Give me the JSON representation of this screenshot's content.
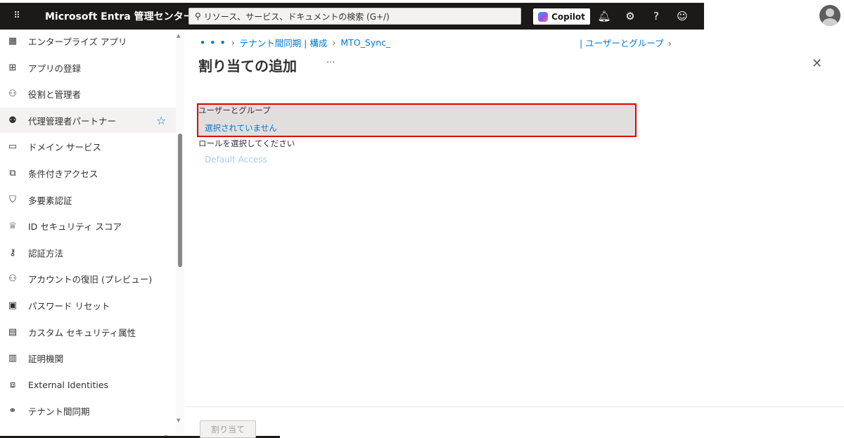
{
  "topbar": {
    "brand": "Microsoft Entra 管理センター",
    "search_placeholder": "リソース、サービス、ドキュメントの検索 (G+/)",
    "copilot_label": "Copilot",
    "icons": [
      "waffle-icon",
      "search-icon",
      "bell-icon",
      "gear-icon",
      "help-icon",
      "feedback-icon",
      "avatar"
    ]
  },
  "sidebar": {
    "items": [
      {
        "label": "エンタープライズ アプリ",
        "icon": "enterprise-apps-icon"
      },
      {
        "label": "アプリの登録",
        "icon": "app-registration-icon"
      },
      {
        "label": "役割と管理者",
        "icon": "roles-icon"
      },
      {
        "label": "代理管理者パートナー",
        "icon": "delegated-admin-icon",
        "selected": true,
        "favorite": true
      },
      {
        "label": "ドメイン サービス",
        "icon": "domain-services-icon"
      },
      {
        "label": "条件付きアクセス",
        "icon": "conditional-access-icon"
      },
      {
        "label": "多要素認証",
        "icon": "mfa-icon"
      },
      {
        "label": "ID セキュリティ スコア",
        "icon": "trophy-icon"
      },
      {
        "label": "認証方法",
        "icon": "auth-methods-icon"
      },
      {
        "label": "アカウントの復旧 (プレビュー)",
        "icon": "account-recovery-icon"
      },
      {
        "label": "パスワード リセット",
        "icon": "password-reset-icon"
      },
      {
        "label": "カスタム セキュリティ属性",
        "icon": "custom-attributes-icon"
      },
      {
        "label": "証明機関",
        "icon": "certificate-icon"
      },
      {
        "label": "External Identities",
        "icon": "external-identities-icon"
      },
      {
        "label": "テナント間同期",
        "icon": "cross-tenant-sync-icon"
      }
    ]
  },
  "breadcrumb": {
    "ellipsis": "• • •",
    "items": [
      "テナント間同期 | 構成",
      "MTO_Sync_"
    ],
    "trailing": "| ユーザーとグループ"
  },
  "page": {
    "title": "割り当ての追加",
    "more": "···",
    "close": "✕"
  },
  "form": {
    "users_label": "ユーザーとグループ",
    "users_value": "選択されていません",
    "role_label": "ロールを選択してください",
    "role_value": "Default Access"
  },
  "footer": {
    "assign_label": "割り当て"
  }
}
